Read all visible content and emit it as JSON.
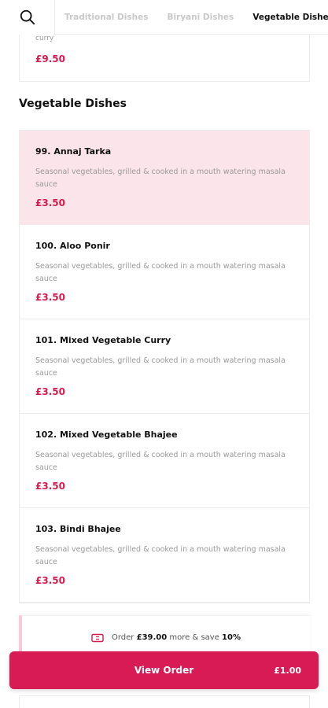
{
  "header": {
    "search_icon": "search-icon",
    "tabs": [
      {
        "label": "Traditional Dishes",
        "active": false
      },
      {
        "label": "Biryani Dishes",
        "active": false
      },
      {
        "label": "Vegetable Dishes",
        "active": true
      }
    ]
  },
  "previous_item": {
    "description_tail": "curry",
    "price": "£9.50"
  },
  "section": {
    "title": "Vegetable Dishes"
  },
  "items": [
    {
      "name": "99. Annaj Tarka",
      "description": "Seasonal vegetables, grilled & cooked in a mouth watering masala sauce",
      "price": "£3.50",
      "highlighted": true
    },
    {
      "name": "100. Aloo Ponir",
      "description": "Seasonal vegetables, grilled & cooked in a mouth watering masala sauce",
      "price": "£3.50",
      "highlighted": false
    },
    {
      "name": "101. Mixed Vegetable Curry",
      "description": "Seasonal vegetables, grilled & cooked in a mouth watering masala sauce",
      "price": "£3.50",
      "highlighted": false
    },
    {
      "name": "102. Mixed Vegetable Bhajee",
      "description": "Seasonal vegetables, grilled & cooked in a mouth watering masala sauce",
      "price": "£3.50",
      "highlighted": false
    },
    {
      "name": "103. Bindi Bhajee",
      "description": "Seasonal vegetables, grilled & cooked in a mouth watering masala sauce",
      "price": "£3.50",
      "highlighted": false
    }
  ],
  "promo": {
    "icon": "ticket-icon",
    "prefix": "Order",
    "amount": "£39.00",
    "middle": "more & save",
    "discount": "10%"
  },
  "order_button": {
    "label": "View Order",
    "total": "£1.00"
  },
  "colors": {
    "accent": "#d81b55",
    "price": "#d81b4f",
    "highlight_bg": "#fbe4ea"
  }
}
